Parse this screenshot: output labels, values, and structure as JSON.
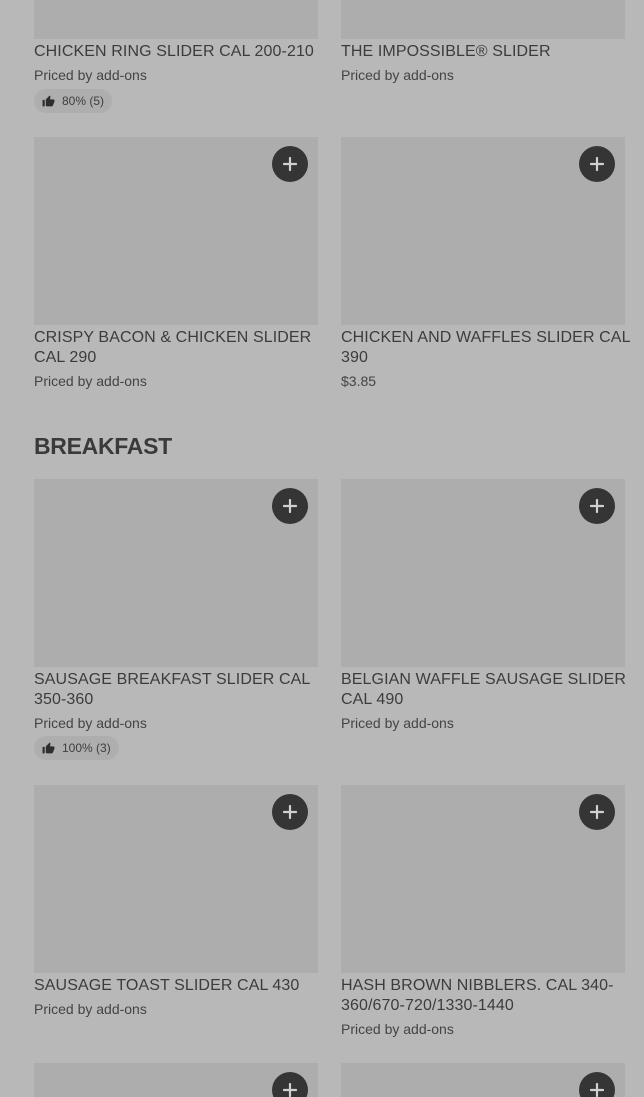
{
  "items": [
    {
      "name": "CHICKEN RING SLIDER CAL 200-210",
      "price": "Priced by add-ons",
      "rating": "80% (5)"
    },
    {
      "name": "THE IMPOSSIBLE® SLIDER",
      "price": "Priced by add-ons"
    },
    {
      "name": "CRISPY BACON & CHICKEN SLIDER CAL 290",
      "price": "Priced by add-ons"
    },
    {
      "name": "CHICKEN AND WAFFLES SLIDER CAL 390",
      "price": "$3.85"
    },
    {
      "name": "SAUSAGE BREAKFAST SLIDER CAL 350-360",
      "price": "Priced by add-ons",
      "rating": "100% (3)"
    },
    {
      "name": "BELGIAN WAFFLE SAUSAGE SLIDER CAL 490",
      "price": "Priced by add-ons"
    },
    {
      "name": "SAUSAGE TOAST SLIDER CAL 430",
      "price": "Priced by add-ons"
    },
    {
      "name": "HASH BROWN NIBBLERS. CAL 340-360/670-720/1330-1440",
      "price": "Priced by add-ons"
    }
  ],
  "sections": {
    "breakfast": "BREAKFAST"
  },
  "icons": {
    "add": "plus-icon",
    "rating": "thumbs-up-icon"
  },
  "colors": {
    "background": "#b8b8b8",
    "image_placeholder": "#adadad",
    "add_button": "#353535"
  }
}
